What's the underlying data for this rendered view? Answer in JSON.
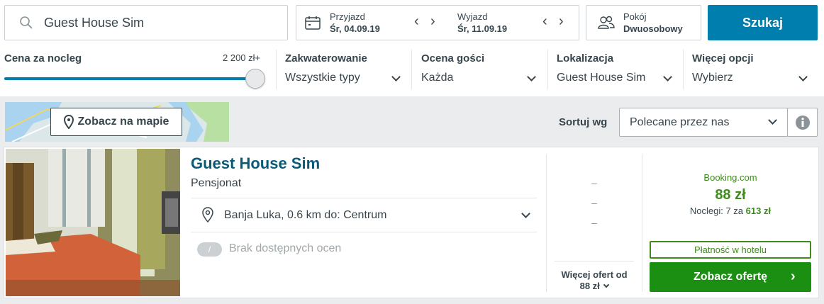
{
  "search": {
    "value": "Guest House Sim"
  },
  "dates": {
    "checkin_label": "Przyjazd",
    "checkin_value": "Śr, 04.09.19",
    "checkout_label": "Wyjazd",
    "checkout_value": "Śr, 11.09.19"
  },
  "room": {
    "label": "Pokój",
    "value": "Dwuosobowy"
  },
  "search_button": "Szukaj",
  "price_filter": {
    "label": "Cena za nocleg",
    "max": "2 200 zł+",
    "level": 1.0
  },
  "filters": [
    {
      "label": "Zakwaterowanie",
      "value": "Wszystkie typy"
    },
    {
      "label": "Ocena gości",
      "value": "Każda"
    },
    {
      "label": "Lokalizacja",
      "value": "Guest House Sim"
    },
    {
      "label": "Więcej opcji",
      "value": "Wybierz"
    }
  ],
  "map_button": "Zobacz na mapie",
  "sort": {
    "label": "Sortuj wg",
    "value": "Polecane przez nas"
  },
  "hotel": {
    "name": "Guest House Sim",
    "type": "Pensjonat",
    "location": "Banja Luka, 0.6 km do: Centrum",
    "rating": "Brak dostępnych ocen",
    "rating_badge": "/"
  },
  "alt_deals": [
    "–",
    "–",
    "–"
  ],
  "more_offers": {
    "line1": "Więcej ofert od",
    "line2": "88 zł"
  },
  "deal": {
    "provider": "Booking.com",
    "price": "88 zł",
    "nights_text": "Noclegi: 7 za",
    "total": "613 zł",
    "payment": "Płatność w hotelu",
    "button": "Zobacz ofertę"
  },
  "colors": {
    "accent": "#007faf",
    "hotel_name": "#0a5a75",
    "deal_green": "#1a8f12",
    "price_green": "#3d8c1b"
  }
}
